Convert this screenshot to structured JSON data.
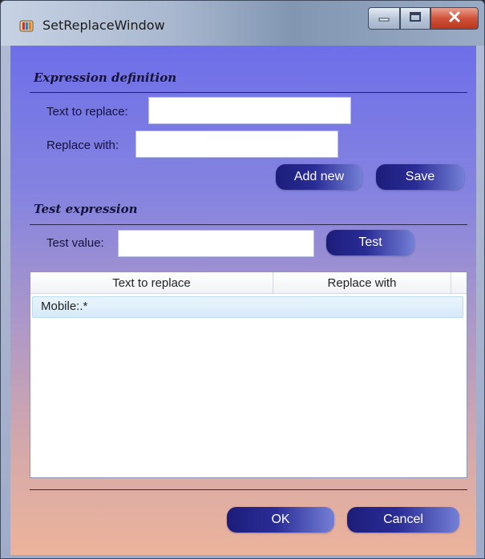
{
  "window": {
    "title": "SetReplaceWindow"
  },
  "expression_definition": {
    "heading": "Expression definition",
    "text_to_replace_label": "Text to replace:",
    "text_to_replace_value": "",
    "replace_with_label": "Replace with:",
    "replace_with_value": "",
    "add_new_label": "Add new",
    "save_label": "Save"
  },
  "test_expression": {
    "heading": "Test expression",
    "test_value_label": "Test value:",
    "test_value_value": "",
    "test_label": "Test"
  },
  "table": {
    "columns": [
      "Text to replace",
      "Replace with"
    ],
    "rows": [
      {
        "text_to_replace": "Mobile:.*",
        "replace_with": ""
      }
    ]
  },
  "footer": {
    "ok_label": "OK",
    "cancel_label": "Cancel"
  },
  "icons": {
    "app_icon": "app-icon",
    "minimize": "minimize-icon",
    "maximize": "maximize-icon",
    "close": "close-icon"
  },
  "colors": {
    "button_gradient_start": "#1c1d7a",
    "button_gradient_end": "#7480d6",
    "background_top": "#6e6fe9",
    "background_bottom": "#ecb39b",
    "close_button": "#d1523a"
  }
}
